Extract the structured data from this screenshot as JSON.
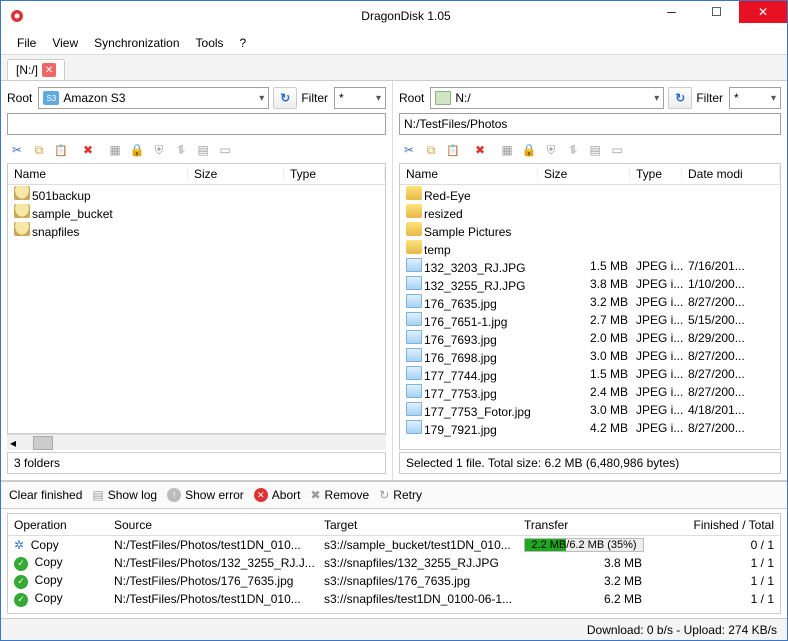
{
  "window": {
    "title": "DragonDisk 1.05"
  },
  "menu": [
    "File",
    "View",
    "Synchronization",
    "Tools",
    "?"
  ],
  "tab": {
    "label": "[N:/]"
  },
  "left": {
    "rootLabel": "Root",
    "rootValue": "Amazon S3",
    "filterLabel": "Filter",
    "filterValue": "*",
    "path": "",
    "cols": {
      "name": "Name",
      "size": "Size",
      "type": "Type"
    },
    "rows": [
      {
        "name": "501backup"
      },
      {
        "name": "sample_bucket"
      },
      {
        "name": "snapfiles"
      }
    ],
    "status": "3 folders"
  },
  "right": {
    "rootLabel": "Root",
    "rootValue": "N:/",
    "filterLabel": "Filter",
    "filterValue": "*",
    "path": "N:/TestFiles/Photos",
    "cols": {
      "name": "Name",
      "size": "Size",
      "type": "Type",
      "date": "Date modi"
    },
    "rows": [
      {
        "kind": "folder",
        "name": "Red-Eye",
        "size": "",
        "type": "",
        "date": ""
      },
      {
        "kind": "folder",
        "name": "resized",
        "size": "",
        "type": "",
        "date": ""
      },
      {
        "kind": "folder",
        "name": "Sample Pictures",
        "size": "",
        "type": "",
        "date": ""
      },
      {
        "kind": "folder",
        "name": "temp",
        "size": "",
        "type": "",
        "date": ""
      },
      {
        "kind": "img",
        "name": "132_3203_RJ.JPG",
        "size": "1.5 MB",
        "type": "JPEG i...",
        "date": "7/16/201..."
      },
      {
        "kind": "img",
        "name": "132_3255_RJ.JPG",
        "size": "3.8 MB",
        "type": "JPEG i...",
        "date": "1/10/200..."
      },
      {
        "kind": "img",
        "name": "176_7635.jpg",
        "size": "3.2 MB",
        "type": "JPEG i...",
        "date": "8/27/200..."
      },
      {
        "kind": "img",
        "name": "176_7651-1.jpg",
        "size": "2.7 MB",
        "type": "JPEG i...",
        "date": "5/15/200..."
      },
      {
        "kind": "img",
        "name": "176_7693.jpg",
        "size": "2.0 MB",
        "type": "JPEG i...",
        "date": "8/29/200..."
      },
      {
        "kind": "img",
        "name": "176_7698.jpg",
        "size": "3.0 MB",
        "type": "JPEG i...",
        "date": "8/27/200..."
      },
      {
        "kind": "img",
        "name": "177_7744.jpg",
        "size": "1.5 MB",
        "type": "JPEG i...",
        "date": "8/27/200..."
      },
      {
        "kind": "img",
        "name": "177_7753.jpg",
        "size": "2.4 MB",
        "type": "JPEG i...",
        "date": "8/27/200..."
      },
      {
        "kind": "img",
        "name": "177_7753_Fotor.jpg",
        "size": "3.0 MB",
        "type": "JPEG i...",
        "date": "4/18/201..."
      },
      {
        "kind": "img",
        "name": "179_7921.jpg",
        "size": "4.2 MB",
        "type": "JPEG i...",
        "date": "8/27/200..."
      }
    ],
    "status": "Selected 1 file. Total size: 6.2 MB (6,480,986 bytes)"
  },
  "qtb": {
    "clear": "Clear finished",
    "showlog": "Show log",
    "showerror": "Show error",
    "abort": "Abort",
    "remove": "Remove",
    "retry": "Retry"
  },
  "queue": {
    "cols": {
      "op": "Operation",
      "src": "Source",
      "tgt": "Target",
      "xfer": "Transfer",
      "fin": "Finished / Total"
    },
    "rows": [
      {
        "status": "running",
        "op": "Copy",
        "src": "N:/TestFiles/Photos/test1DN_010...",
        "tgt": "s3://sample_bucket/test1DN_010...",
        "progress": {
          "done": "2.2 MB",
          "total": "6.2 MB",
          "pct": "35%"
        },
        "fin": "0 / 1"
      },
      {
        "status": "done",
        "op": "Copy",
        "src": "N:/TestFiles/Photos/132_3255_RJ.J...",
        "tgt": "s3://snapfiles/132_3255_RJ.JPG",
        "size": "3.8 MB",
        "fin": "1 / 1"
      },
      {
        "status": "done",
        "op": "Copy",
        "src": "N:/TestFiles/Photos/176_7635.jpg",
        "tgt": "s3://snapfiles/176_7635.jpg",
        "size": "3.2 MB",
        "fin": "1 / 1"
      },
      {
        "status": "done",
        "op": "Copy",
        "src": "N:/TestFiles/Photos/test1DN_010...",
        "tgt": "s3://snapfiles/test1DN_0100-06-1...",
        "size": "6.2 MB",
        "fin": "1 / 1"
      }
    ]
  },
  "statusbar": "Download: 0 b/s - Upload: 274 KB/s"
}
